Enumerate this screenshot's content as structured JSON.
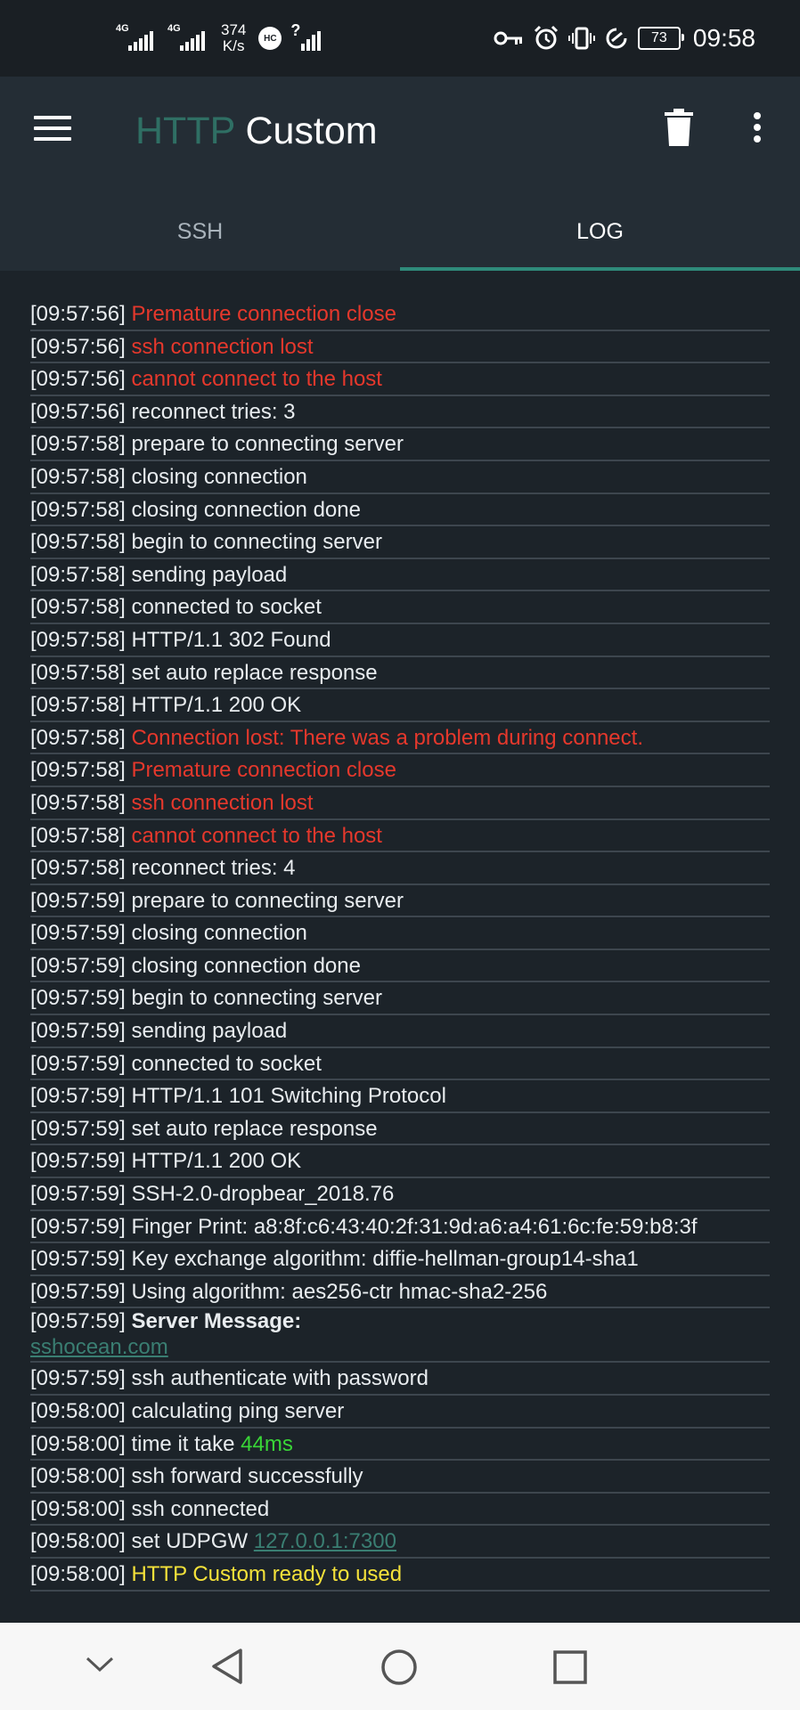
{
  "status_bar": {
    "network1": "4G",
    "network2": "4G",
    "speed_value": "374",
    "speed_unit": "K/s",
    "hc_badge": "HC",
    "wifi_q": "?",
    "battery": "73",
    "time": "09:58",
    "icons": [
      "vpn-key-icon",
      "alarm-icon",
      "vibrate-icon",
      "data-saver-icon",
      "battery-icon"
    ]
  },
  "app_bar": {
    "title_part1": "HTTP",
    "title_part2": "Custom",
    "icons": [
      "menu-icon",
      "trash-icon",
      "more-vert-icon"
    ]
  },
  "tabs": [
    {
      "label": "SSH",
      "active": false
    },
    {
      "label": "LOG",
      "active": true
    }
  ],
  "log": [
    {
      "time": "[09:57:56]",
      "text": "Premature connection close",
      "color": "red"
    },
    {
      "time": "[09:57:56]",
      "text": "ssh connection lost",
      "color": "red"
    },
    {
      "time": "[09:57:56]",
      "text": "cannot connect to the host",
      "color": "red"
    },
    {
      "time": "[09:57:56]",
      "text": "reconnect tries: 3"
    },
    {
      "time": "[09:57:58]",
      "text": "prepare to connecting server"
    },
    {
      "time": "[09:57:58]",
      "text": "closing connection"
    },
    {
      "time": "[09:57:58]",
      "text": "closing connection done"
    },
    {
      "time": "[09:57:58]",
      "text": "begin to connecting server"
    },
    {
      "time": "[09:57:58]",
      "text": "sending payload"
    },
    {
      "time": "[09:57:58]",
      "text": "connected to socket"
    },
    {
      "time": "[09:57:58]",
      "text": "HTTP/1.1 302 Found"
    },
    {
      "time": "[09:57:58]",
      "text": "set auto replace response"
    },
    {
      "time": "[09:57:58]",
      "text": "HTTP/1.1 200 OK"
    },
    {
      "time": "[09:57:58]",
      "text": "Connection lost: There was a problem during connect.",
      "color": "red"
    },
    {
      "time": "[09:57:58]",
      "text": "Premature connection close",
      "color": "red"
    },
    {
      "time": "[09:57:58]",
      "text": "ssh connection lost",
      "color": "red"
    },
    {
      "time": "[09:57:58]",
      "text": "cannot connect to the host",
      "color": "red"
    },
    {
      "time": "[09:57:58]",
      "text": "reconnect tries: 4"
    },
    {
      "time": "[09:57:59]",
      "text": "prepare to connecting server"
    },
    {
      "time": "[09:57:59]",
      "text": "closing connection"
    },
    {
      "time": "[09:57:59]",
      "text": "closing connection done"
    },
    {
      "time": "[09:57:59]",
      "text": "begin to connecting server"
    },
    {
      "time": "[09:57:59]",
      "text": "sending payload"
    },
    {
      "time": "[09:57:59]",
      "text": "connected to socket"
    },
    {
      "time": "[09:57:59]",
      "text": "HTTP/1.1 101 Switching Protocol"
    },
    {
      "time": "[09:57:59]",
      "text": "set auto replace response"
    },
    {
      "time": "[09:57:59]",
      "text": "HTTP/1.1 200 OK"
    },
    {
      "time": "[09:57:59]",
      "text": "SSH-2.0-dropbear_2018.76"
    },
    {
      "time": "[09:57:59]",
      "text": "Finger Print: a8:8f:c6:43:40:2f:31:9d:a6:a4:61:6c:fe:59:b8:3f"
    },
    {
      "time": "[09:57:59]",
      "text": "Key exchange algorithm: diffie-hellman-group14-sha1"
    },
    {
      "time": "[09:57:59]",
      "text": "Using algorithm: aes256-ctr hmac-sha2-256"
    },
    {
      "time": "[09:57:59]",
      "text": "Server Message:",
      "bold": true,
      "sub": "sshocean.com"
    },
    {
      "time": "[09:57:59]",
      "text": "ssh authenticate with password"
    },
    {
      "time": "[09:58:00]",
      "text": "calculating ping server"
    },
    {
      "time": "[09:58:00]",
      "text": "time it take",
      "tail": "44ms",
      "tail_color": "green"
    },
    {
      "time": "[09:58:00]",
      "text": "ssh forward successfully"
    },
    {
      "time": "[09:58:00]",
      "text": "ssh connected"
    },
    {
      "time": "[09:58:00]",
      "text": "set UDPGW",
      "tail": "127.0.0.1:7300",
      "tail_color": "teal"
    },
    {
      "time": "[09:58:00]",
      "text": "HTTP Custom ready to used",
      "color": "yellow"
    }
  ],
  "nav_bar": {
    "icons": [
      "hide-keyboard-icon",
      "back-icon",
      "home-icon",
      "recents-icon"
    ]
  },
  "colors": {
    "background": "#1c2329",
    "app_bar": "#242d35",
    "accent": "#2f8a7a",
    "error": "#e5382c",
    "success": "#39d637",
    "ready": "#f5e23a",
    "link": "#3a7e72"
  }
}
